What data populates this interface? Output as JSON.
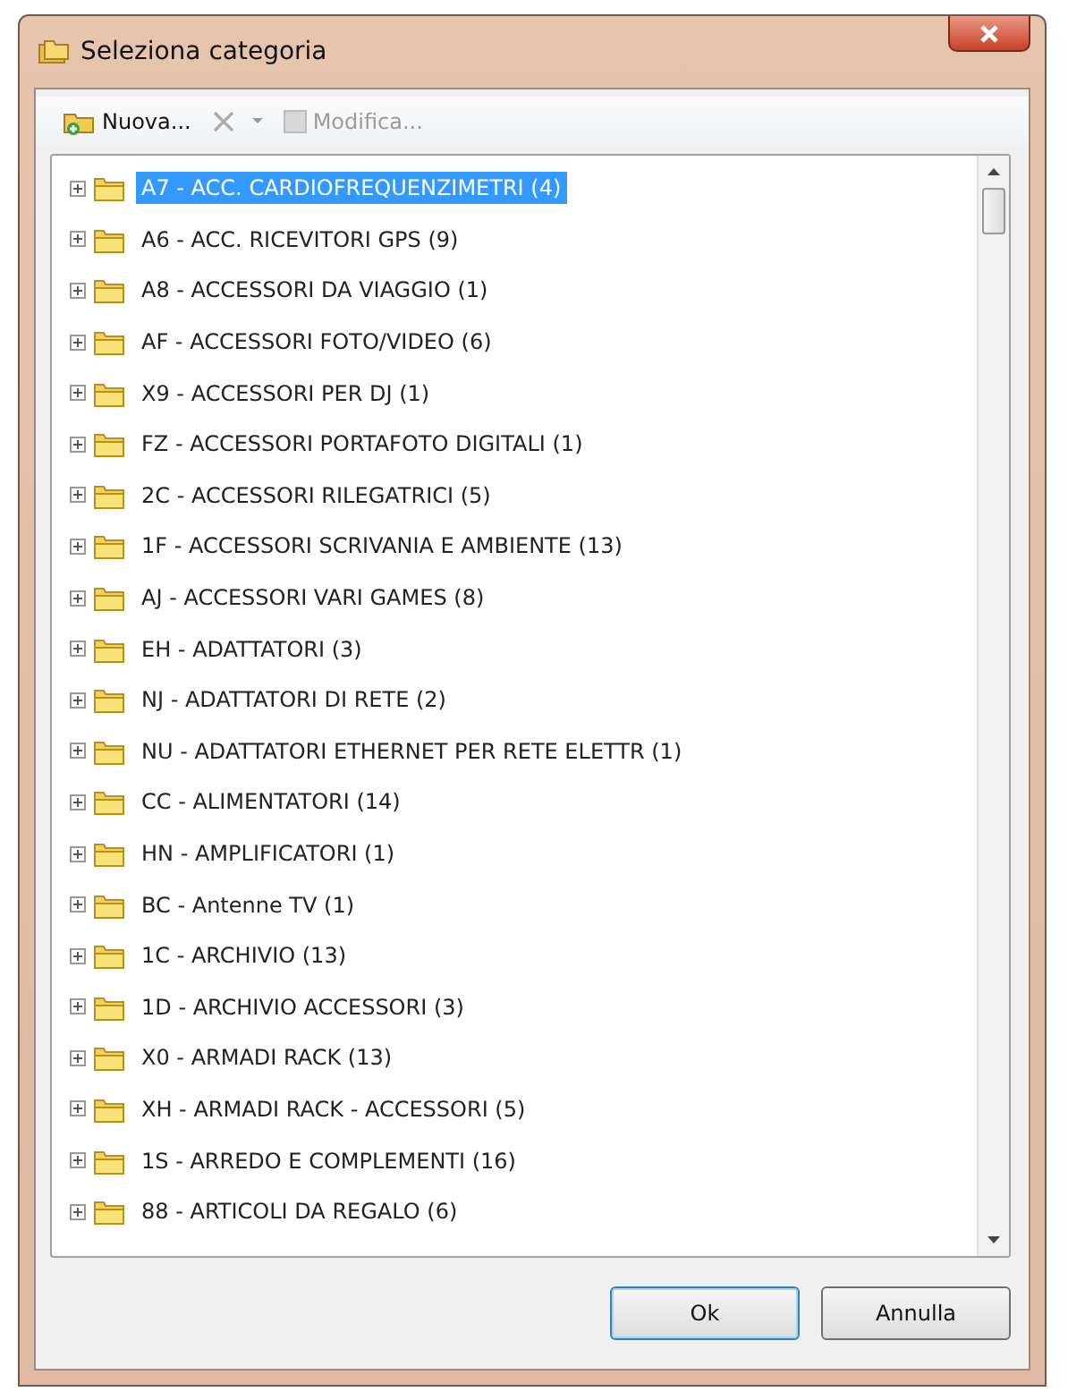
{
  "window": {
    "title": "Seleziona categoria"
  },
  "toolbar": [
    {
      "kind": "new",
      "label": "Nuova...",
      "disabled": false
    },
    {
      "kind": "delete",
      "disabled": true
    },
    {
      "kind": "edit",
      "label": "Modifica...",
      "disabled": true
    }
  ],
  "tree": {
    "items": [
      {
        "label": "A7 - ACC. CARDIOFREQUENZIMETRI (4)",
        "selected": true
      },
      {
        "label": "A6 - ACC. RICEVITORI GPS (9)",
        "selected": false
      },
      {
        "label": "A8 - ACCESSORI DA VIAGGIO (1)",
        "selected": false
      },
      {
        "label": "AF - ACCESSORI FOTO/VIDEO (6)",
        "selected": false
      },
      {
        "label": "X9 - ACCESSORI PER DJ (1)",
        "selected": false
      },
      {
        "label": "FZ - ACCESSORI PORTAFOTO DIGITALI (1)",
        "selected": false
      },
      {
        "label": "2C - ACCESSORI RILEGATRICI (5)",
        "selected": false
      },
      {
        "label": "1F - ACCESSORI SCRIVANIA E AMBIENTE (13)",
        "selected": false
      },
      {
        "label": "AJ - ACCESSORI VARI GAMES (8)",
        "selected": false
      },
      {
        "label": "EH - ADATTATORI (3)",
        "selected": false
      },
      {
        "label": "NJ - ADATTATORI DI RETE (2)",
        "selected": false
      },
      {
        "label": "NU - ADATTATORI ETHERNET PER RETE ELETTR (1)",
        "selected": false
      },
      {
        "label": "CC - ALIMENTATORI (14)",
        "selected": false
      },
      {
        "label": "HN - AMPLIFICATORI (1)",
        "selected": false
      },
      {
        "label": "BC - Antenne TV (1)",
        "selected": false
      },
      {
        "label": "1C - ARCHIVIO (13)",
        "selected": false
      },
      {
        "label": "1D - ARCHIVIO ACCESSORI (3)",
        "selected": false
      },
      {
        "label": "X0 - ARMADI RACK (13)",
        "selected": false
      },
      {
        "label": "XH - ARMADI RACK - ACCESSORI (5)",
        "selected": false
      },
      {
        "label": "1S - ARREDO E COMPLEMENTI (16)",
        "selected": false
      },
      {
        "label": "88 - ARTICOLI DA REGALO (6)",
        "selected": false
      }
    ]
  },
  "buttons": [
    {
      "label": "Ok",
      "default": true
    },
    {
      "label": "Annulla",
      "default": false
    }
  ]
}
